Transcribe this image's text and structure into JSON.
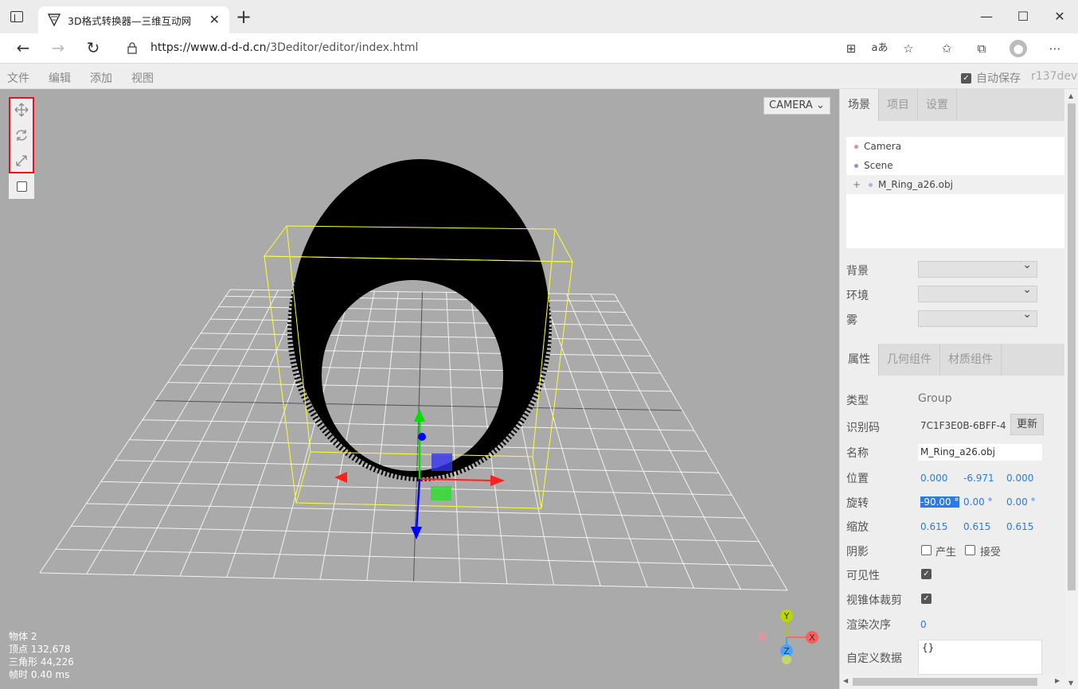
{
  "browser": {
    "tab_title": "3D格式转换器—三维互动网",
    "url_host": "https://www.d-d-d.cn",
    "url_path": "/3Deditor/editor/index.html"
  },
  "menu": {
    "file": "文件",
    "edit": "编辑",
    "add": "添加",
    "view": "视图",
    "autosave": "自动保存",
    "version": "r137dev"
  },
  "viewport": {
    "camera": "CAMERA",
    "info": {
      "objects_label": "物体",
      "objects": "2",
      "vertices_label": "顶点",
      "vertices": "132,678",
      "triangles_label": "三角形",
      "triangles": "44,226",
      "frametime_label": "帧时",
      "frametime": "0.40 ms"
    },
    "gizmo": {
      "x": "X",
      "y": "Y",
      "z": "Z"
    }
  },
  "sidebar": {
    "tabs": [
      "场景",
      "项目",
      "设置"
    ],
    "outliner": [
      {
        "label": "Camera",
        "color": "#e08f8f"
      },
      {
        "label": "Scene",
        "color": "#8f8fd0"
      },
      {
        "label": "M_Ring_a26.obj",
        "color": "#b0b0f0"
      }
    ],
    "background_label": "背景",
    "environment_label": "环境",
    "fog_label": "雾",
    "prop_tabs": [
      "属性",
      "几何组件",
      "材质组件"
    ],
    "props": {
      "type_label": "类型",
      "type": "Group",
      "uuid_label": "识别码",
      "uuid": "7C1F3E0B-6BFF-4",
      "renew": "更新",
      "name_label": "名称",
      "name": "M_Ring_a26.obj",
      "position_label": "位置",
      "position": [
        "0.000",
        "-6.971",
        "0.000"
      ],
      "rotation_label": "旋转",
      "rotation": [
        "-90.00 °",
        "0.00 °",
        "0.00 °"
      ],
      "scale_label": "缩放",
      "scale": [
        "0.615",
        "0.615",
        "0.615"
      ],
      "shadow_label": "阴影",
      "cast": "产生",
      "receive": "接受",
      "visible_label": "可见性",
      "frustum_label": "视锥体裁剪",
      "render_order_label": "渲染次序",
      "render_order": "0",
      "userdata_label": "自定义数据",
      "userdata": "{}"
    }
  }
}
